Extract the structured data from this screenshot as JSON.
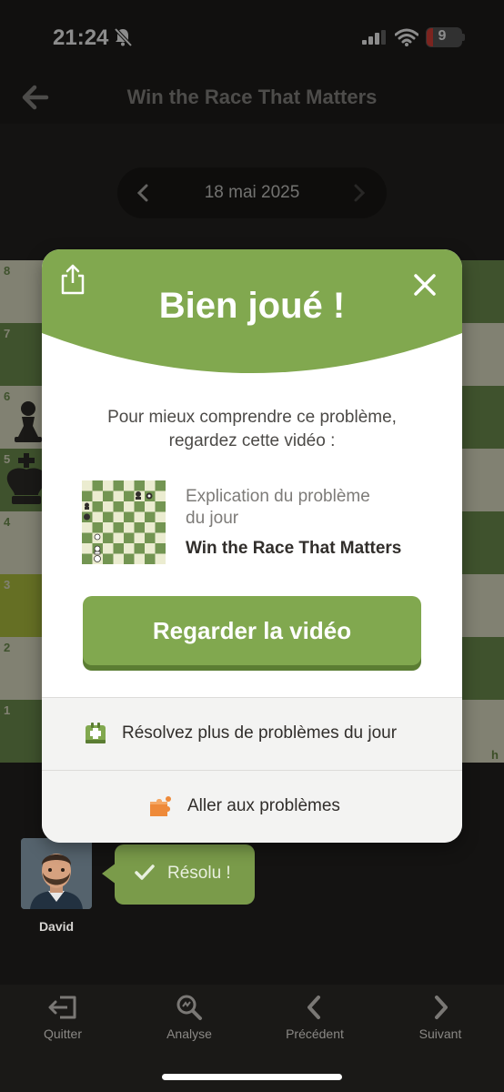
{
  "status_bar": {
    "time": "21:24",
    "battery": "9"
  },
  "header": {
    "title": "Win the Race That Matters"
  },
  "date_nav": {
    "date": "18 mai 2025"
  },
  "board": {
    "ranks": [
      "8",
      "7",
      "6",
      "5",
      "4",
      "3",
      "2",
      "1"
    ],
    "file_label": "h"
  },
  "modal": {
    "title": "Bien joué !",
    "text_line1": "Pour mieux comprendre ce problème,",
    "text_line2": "regardez cette vidéo :",
    "video_subtitle_line1": "Explication du problème",
    "video_subtitle_line2": "du jour",
    "video_title": "Win the Race That Matters",
    "watch_button": "Regarder la vidéo",
    "more_puzzles": "Résolvez plus de problèmes du jour",
    "go_puzzles": "Aller aux problèmes"
  },
  "coach": {
    "name": "David",
    "message": "Résolu !"
  },
  "bottom_nav": {
    "quit": "Quitter",
    "analysis": "Analyse",
    "previous": "Précédent",
    "next": "Suivant"
  },
  "colors": {
    "accent_green": "#81a84f",
    "background": "#262421"
  }
}
